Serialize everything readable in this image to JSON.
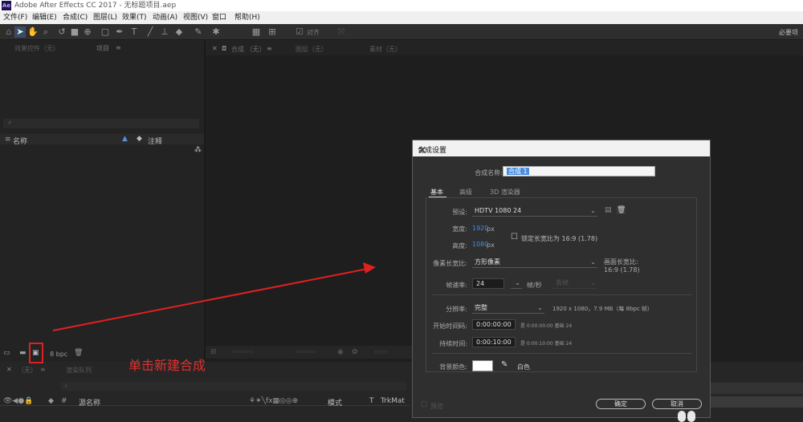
{
  "window": {
    "title": "Adobe After Effects CC 2017 - 无标题项目.aep",
    "logo_text": "Ae"
  },
  "menu": [
    "文件(F)",
    "编辑(E)",
    "合成(C)",
    "图层(L)",
    "效果(T)",
    "动画(A)",
    "视图(V)",
    "窗口",
    "帮助(H)"
  ],
  "toolbar": {
    "snap_label": "对齐",
    "workspace_label": "必要项"
  },
  "left_panel": {
    "tabs": [
      "效果控件（无）",
      "项目"
    ],
    "columns": {
      "name": "名称",
      "comment": "注释"
    },
    "bpc": "8 bpc"
  },
  "viewer": {
    "tabs": [
      "合成 （无）",
      "图层（无）",
      "素材（无）"
    ]
  },
  "timeline": {
    "tab_none": "（无）",
    "tab_render": "渲染队列",
    "col_source": "源名称",
    "col_mode": "模式",
    "col_t": "T",
    "col_trkmat": "TrkMat"
  },
  "annotation": {
    "text": "单击新建合成"
  },
  "dialog": {
    "title": "合成设置",
    "name_label": "合成名称:",
    "name_value": "合成 1",
    "tabs": [
      "基本",
      "高级",
      "3D 渲染器"
    ],
    "preset_label": "预设:",
    "preset_value": "HDTV 1080 24",
    "width_label": "宽度:",
    "width_value": "1920",
    "height_label": "高度:",
    "height_value": "1080",
    "px_unit": "px",
    "lock_label": "锁定长宽比为 16:9 (1.78)",
    "par_label": "像素长宽比:",
    "par_value": "方形像素",
    "frame_ar_label": "画面长宽比:",
    "frame_ar_value": "16:9 (1.78)",
    "fps_label": "帧速率:",
    "fps_value": "24",
    "fps_unit": "帧/秒",
    "drop_frame": "丢帧",
    "res_label": "分辨率:",
    "res_value": "完整",
    "res_info": "1920 x 1080，7.9 MB（每 8bpc 帧）",
    "start_label": "开始时间码:",
    "start_value": "0:00:00:00",
    "start_info": "是 0:00:00:00  基础 24",
    "duration_label": "持续时间:",
    "duration_value": "0:00:10:00",
    "duration_info": "是 0:00:10:00  基础 24",
    "bg_label": "背景颜色:",
    "bg_color_name": "白色",
    "bg_color": "#ffffff",
    "preview_label": "预览",
    "ok_label": "确定",
    "cancel_label": "取消"
  },
  "colors": {
    "accent": "#3d8ee8",
    "annotation": "#e02020"
  }
}
